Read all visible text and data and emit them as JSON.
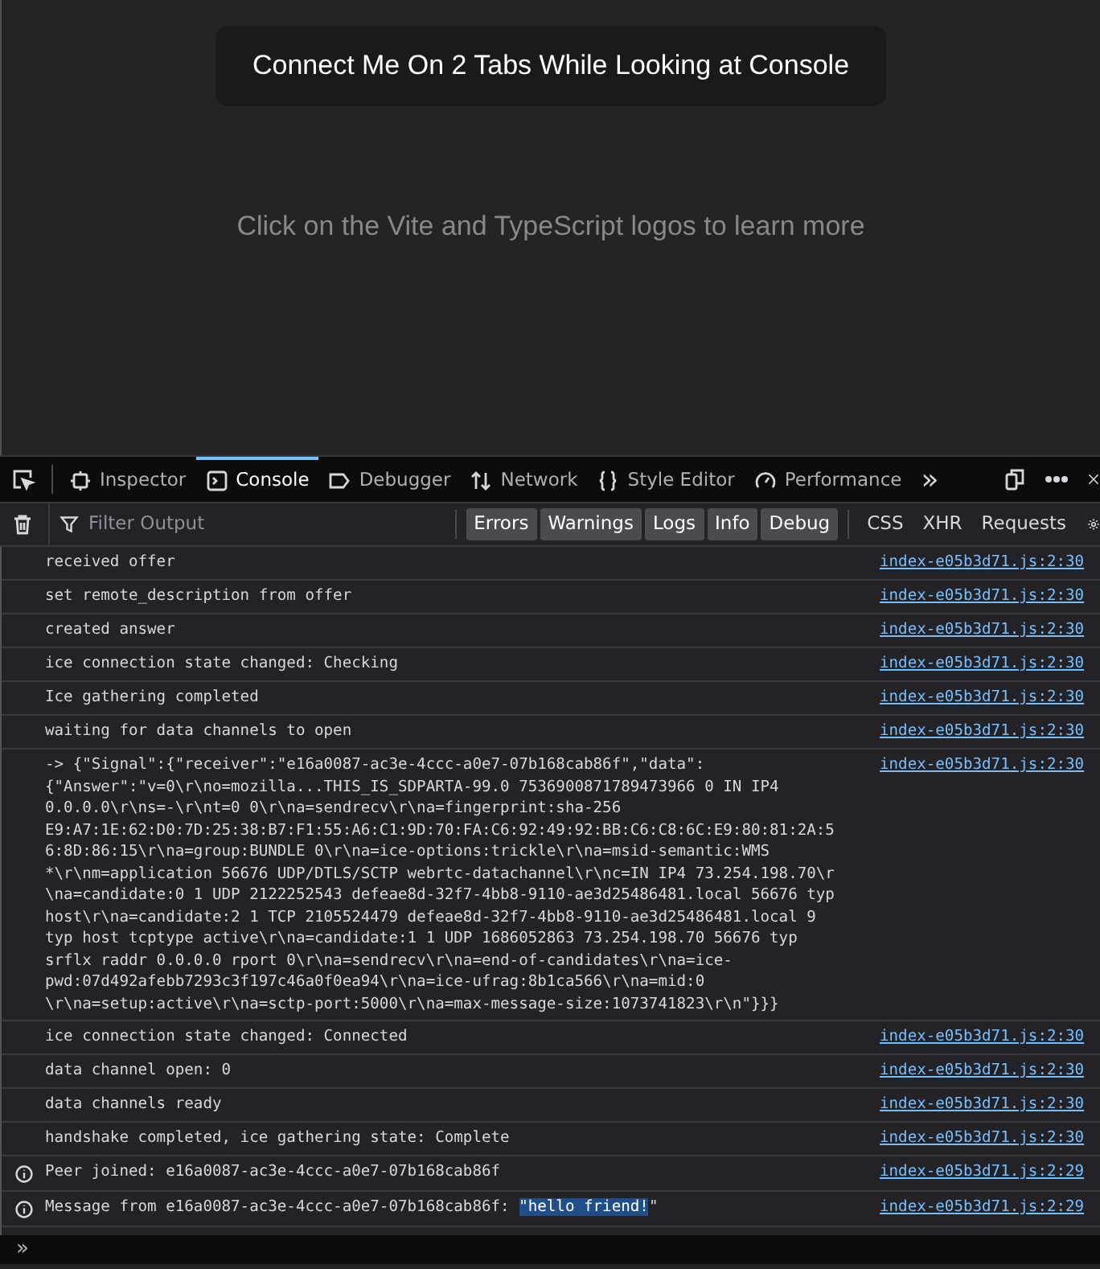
{
  "page": {
    "button": "Connect Me On 2 Tabs While Looking at Console",
    "hint": "Click on the Vite and TypeScript logos to learn more"
  },
  "devtools": {
    "tabs": [
      {
        "label": "Inspector",
        "selected": false
      },
      {
        "label": "Console",
        "selected": true
      },
      {
        "label": "Debugger",
        "selected": false
      },
      {
        "label": "Network",
        "selected": false
      },
      {
        "label": "Style Editor",
        "selected": false
      },
      {
        "label": "Performance",
        "selected": false
      }
    ],
    "overflow": "»",
    "filter": {
      "placeholder": "Filter Output"
    },
    "levels": [
      {
        "label": "Errors",
        "on": true
      },
      {
        "label": "Warnings",
        "on": true
      },
      {
        "label": "Logs",
        "on": true
      },
      {
        "label": "Info",
        "on": true
      },
      {
        "label": "Debug",
        "on": true
      }
    ],
    "types": [
      {
        "label": "CSS",
        "on": false
      },
      {
        "label": "XHR",
        "on": false
      },
      {
        "label": "Requests",
        "on": false
      }
    ],
    "messages": [
      {
        "kind": "log",
        "lines": [
          "received offer"
        ],
        "source": "index-e05b3d71.js:2:30"
      },
      {
        "kind": "log",
        "lines": [
          "set remote_description from offer"
        ],
        "source": "index-e05b3d71.js:2:30"
      },
      {
        "kind": "log",
        "lines": [
          "created answer"
        ],
        "source": "index-e05b3d71.js:2:30"
      },
      {
        "kind": "log",
        "lines": [
          "ice connection state changed: Checking"
        ],
        "source": "index-e05b3d71.js:2:30"
      },
      {
        "kind": "log",
        "lines": [
          "Ice gathering completed"
        ],
        "source": "index-e05b3d71.js:2:30"
      },
      {
        "kind": "log",
        "lines": [
          "waiting for data channels to open"
        ],
        "source": "index-e05b3d71.js:2:30"
      },
      {
        "kind": "log",
        "lines": [
          "-> {\"Signal\":{\"receiver\":\"e16a0087-ac3e-4ccc-a0e7-07b168cab86f\",\"data\":",
          "{\"Answer\":\"v=0\\r\\no=mozilla...THIS_IS_SDPARTA-99.0 7536900871789473966 0 IN IP4",
          "0.0.0.0\\r\\ns=-\\r\\nt=0 0\\r\\na=sendrecv\\r\\na=fingerprint:sha-256",
          "E9:A7:1E:62:D0:7D:25:38:B7:F1:55:A6:C1:9D:70:FA:C6:92:49:92:BB:C6:C8:6C:E9:80:81:2A:5",
          "6:8D:86:15\\r\\na=group:BUNDLE 0\\r\\na=ice-options:trickle\\r\\na=msid-semantic:WMS",
          "*\\r\\nm=application 56676 UDP/DTLS/SCTP webrtc-datachannel\\r\\nc=IN IP4 73.254.198.70\\r",
          "\\na=candidate:0 1 UDP 2122252543 defeae8d-32f7-4bb8-9110-ae3d25486481.local 56676 typ",
          "host\\r\\na=candidate:2 1 TCP 2105524479 defeae8d-32f7-4bb8-9110-ae3d25486481.local 9",
          "typ host tcptype active\\r\\na=candidate:1 1 UDP 1686052863 73.254.198.70 56676 typ",
          "srflx raddr 0.0.0.0 rport 0\\r\\na=sendrecv\\r\\na=end-of-candidates\\r\\na=ice-",
          "pwd:07d492afebb7293c3f197c46a0f0ea94\\r\\na=ice-ufrag:8b1ca566\\r\\na=mid:0",
          "\\r\\na=setup:active\\r\\na=sctp-port:5000\\r\\na=max-message-size:1073741823\\r\\n\"}}}"
        ],
        "source": "index-e05b3d71.js:2:30"
      },
      {
        "kind": "log",
        "lines": [
          "ice connection state changed: Connected"
        ],
        "source": "index-e05b3d71.js:2:30"
      },
      {
        "kind": "log",
        "lines": [
          "data channel open: 0"
        ],
        "source": "index-e05b3d71.js:2:30"
      },
      {
        "kind": "log",
        "lines": [
          "data channels ready"
        ],
        "source": "index-e05b3d71.js:2:30"
      },
      {
        "kind": "log",
        "lines": [
          "handshake completed, ice gathering state: Complete"
        ],
        "source": "index-e05b3d71.js:2:30"
      },
      {
        "kind": "info",
        "lines": [
          "Peer joined: e16a0087-ac3e-4ccc-a0e7-07b168cab86f"
        ],
        "source": "index-e05b3d71.js:2:29"
      },
      {
        "kind": "info",
        "lines": [
          "Message from e16a0087-ac3e-4ccc-a0e7-07b168cab86f: "
        ],
        "highlight": "\"hello friend!",
        "after": "\"",
        "source": "index-e05b3d71.js:2:29"
      }
    ],
    "prompt": "»"
  }
}
